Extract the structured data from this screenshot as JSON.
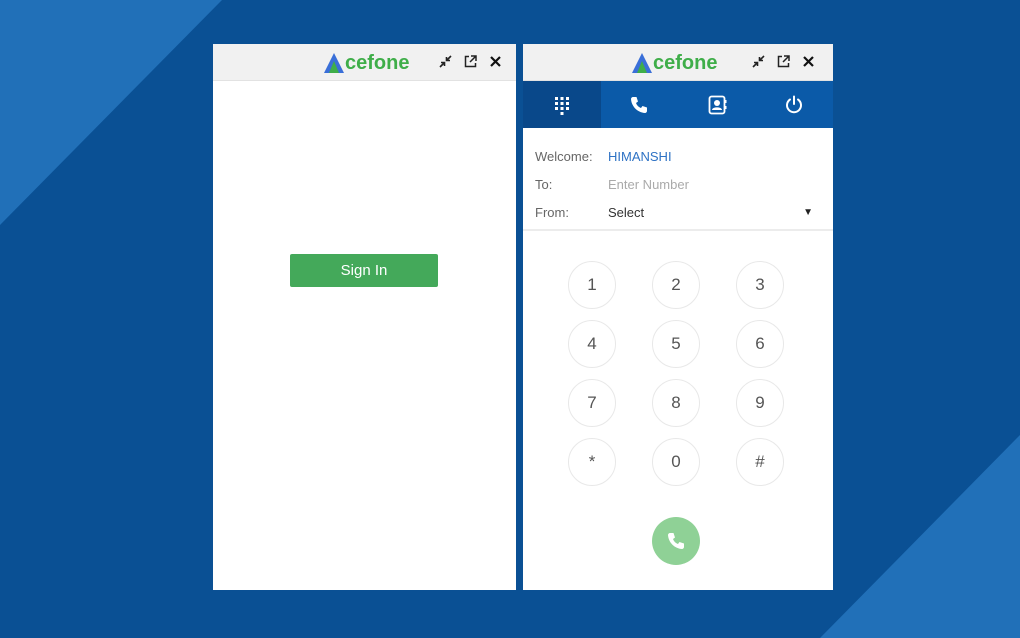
{
  "brand": {
    "name": "Acefone",
    "logo_letter": "A",
    "logo_rest": "cefone",
    "logo_color": "#3fae49",
    "mark_color": "#3a6fd8"
  },
  "left_panel": {
    "sign_in_label": "Sign In",
    "button_color": "#44a95a"
  },
  "right_panel": {
    "tabs": [
      {
        "icon": "dialpad-icon",
        "active": true
      },
      {
        "icon": "phone-icon",
        "active": false
      },
      {
        "icon": "contacts-icon",
        "active": false
      },
      {
        "icon": "power-icon",
        "active": false
      }
    ],
    "welcome_label": "Welcome:",
    "welcome_user": "HIMANSHI",
    "to_label": "To:",
    "to_placeholder": "Enter Number",
    "from_label": "From:",
    "from_value": "Select",
    "keys": [
      "1",
      "2",
      "3",
      "4",
      "5",
      "6",
      "7",
      "8",
      "9",
      "*",
      "0",
      "#"
    ],
    "call_button_color": "#8fd196",
    "nav_color": "#0b5aa8"
  },
  "window_controls": [
    "collapse-icon",
    "popout-icon",
    "close-icon"
  ],
  "background_color": "#0a5094"
}
